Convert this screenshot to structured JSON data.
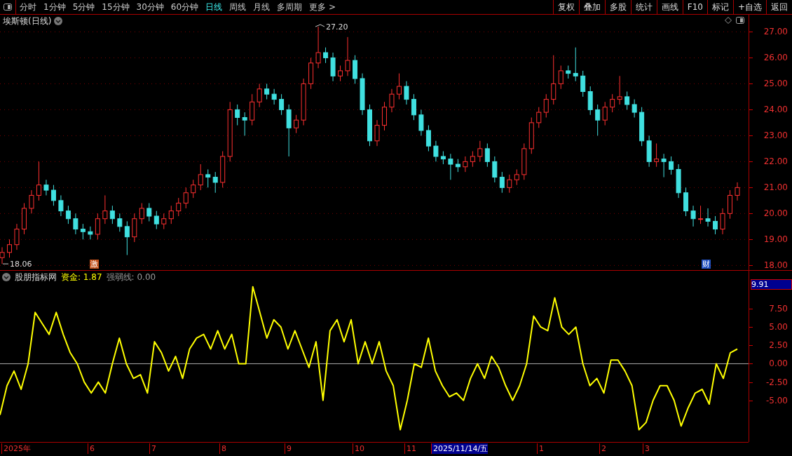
{
  "toolbar": {
    "periods": [
      {
        "label": "分时",
        "selected": false
      },
      {
        "label": "1分钟",
        "selected": false
      },
      {
        "label": "5分钟",
        "selected": false
      },
      {
        "label": "15分钟",
        "selected": false
      },
      {
        "label": "30分钟",
        "selected": false
      },
      {
        "label": "60分钟",
        "selected": false
      },
      {
        "label": "日线",
        "selected": true
      },
      {
        "label": "周线",
        "selected": false
      },
      {
        "label": "月线",
        "selected": false
      },
      {
        "label": "多周期",
        "selected": false
      }
    ],
    "more": "更多 >",
    "buttons": [
      "复权",
      "叠加",
      "多股",
      "统计",
      "画线",
      "F10",
      "标记",
      "+自选",
      "返回"
    ]
  },
  "price_panel": {
    "title": "埃斯顿(日线)",
    "high_label": "27.20",
    "low_label": "18.06",
    "markers": [
      {
        "label": "激",
        "color": "#c0501a"
      },
      {
        "label": "财",
        "color": "#2050c0"
      }
    ],
    "chart_data": {
      "type": "candlestick",
      "ylim": [
        17.82,
        27.66
      ],
      "grid": true,
      "yticks": [
        {
          "value": 27,
          "label": "27.00"
        },
        {
          "value": 26,
          "label": "26.00"
        },
        {
          "value": 25,
          "label": "25.00"
        },
        {
          "value": 24,
          "label": "24.00"
        },
        {
          "value": 23,
          "label": "23.00"
        },
        {
          "value": 22,
          "label": "22.00"
        },
        {
          "value": 21,
          "label": "21.00"
        },
        {
          "value": 20,
          "label": "20.00"
        },
        {
          "value": 19,
          "label": "19.00"
        },
        {
          "value": 18,
          "label": "18.00"
        }
      ],
      "ohlc": [
        [
          18.3,
          18.7,
          18.06,
          18.5
        ],
        [
          18.5,
          19.0,
          18.3,
          18.8
        ],
        [
          18.8,
          19.6,
          18.6,
          19.4
        ],
        [
          19.4,
          20.4,
          19.2,
          20.2
        ],
        [
          20.2,
          20.9,
          20.0,
          20.7
        ],
        [
          20.7,
          22.0,
          20.5,
          21.1
        ],
        [
          21.1,
          21.3,
          20.7,
          20.9
        ],
        [
          20.9,
          21.1,
          20.3,
          20.5
        ],
        [
          20.5,
          20.7,
          19.9,
          20.1
        ],
        [
          20.1,
          20.3,
          19.6,
          19.8
        ],
        [
          19.8,
          20.0,
          19.2,
          19.4
        ],
        [
          19.4,
          19.6,
          19.0,
          19.3
        ],
        [
          19.3,
          19.5,
          19.0,
          19.2
        ],
        [
          19.2,
          20.0,
          19.0,
          19.8
        ],
        [
          19.8,
          20.7,
          19.6,
          20.1
        ],
        [
          20.1,
          20.3,
          19.6,
          19.8
        ],
        [
          19.8,
          20.0,
          19.3,
          19.5
        ],
        [
          19.5,
          19.7,
          18.4,
          19.1
        ],
        [
          19.1,
          20.0,
          18.9,
          19.8
        ],
        [
          19.8,
          20.4,
          19.6,
          20.2
        ],
        [
          20.2,
          20.4,
          19.7,
          19.9
        ],
        [
          19.9,
          20.1,
          19.4,
          19.6
        ],
        [
          19.6,
          20.0,
          19.4,
          19.8
        ],
        [
          19.8,
          20.3,
          19.6,
          20.1
        ],
        [
          20.1,
          20.6,
          19.9,
          20.4
        ],
        [
          20.4,
          21.0,
          20.2,
          20.8
        ],
        [
          20.8,
          21.3,
          20.6,
          21.1
        ],
        [
          21.1,
          21.9,
          20.9,
          21.5
        ],
        [
          21.5,
          21.7,
          21.0,
          21.4
        ],
        [
          21.4,
          21.6,
          20.8,
          21.2
        ],
        [
          21.2,
          22.4,
          21.0,
          22.2
        ],
        [
          22.2,
          24.3,
          22.0,
          24.0
        ],
        [
          24.0,
          24.2,
          23.4,
          23.7
        ],
        [
          23.7,
          23.9,
          23.0,
          23.6
        ],
        [
          23.6,
          24.6,
          23.4,
          24.3
        ],
        [
          24.3,
          25.0,
          24.1,
          24.8
        ],
        [
          24.8,
          25.0,
          24.4,
          24.6
        ],
        [
          24.6,
          24.8,
          24.2,
          24.4
        ],
        [
          24.4,
          24.6,
          23.8,
          24.0
        ],
        [
          24.0,
          24.2,
          22.2,
          23.3
        ],
        [
          23.3,
          23.8,
          23.1,
          23.6
        ],
        [
          23.6,
          25.2,
          23.4,
          25.0
        ],
        [
          25.0,
          26.0,
          24.8,
          25.8
        ],
        [
          25.8,
          27.2,
          25.6,
          26.2
        ],
        [
          26.2,
          26.4,
          25.8,
          26.0
        ],
        [
          26.0,
          26.2,
          25.1,
          25.3
        ],
        [
          25.3,
          25.7,
          25.1,
          25.5
        ],
        [
          25.5,
          26.8,
          25.3,
          25.9
        ],
        [
          25.9,
          26.1,
          25.0,
          25.2
        ],
        [
          25.2,
          25.4,
          23.8,
          24.0
        ],
        [
          24.0,
          24.2,
          22.6,
          22.8
        ],
        [
          22.8,
          23.6,
          22.6,
          23.4
        ],
        [
          23.4,
          24.3,
          23.2,
          24.1
        ],
        [
          24.1,
          24.8,
          23.9,
          24.6
        ],
        [
          24.6,
          25.4,
          24.4,
          24.9
        ],
        [
          24.9,
          25.1,
          24.2,
          24.4
        ],
        [
          24.4,
          24.6,
          23.6,
          23.8
        ],
        [
          23.8,
          24.0,
          23.0,
          23.2
        ],
        [
          23.2,
          23.4,
          22.4,
          22.6
        ],
        [
          22.6,
          22.8,
          22.0,
          22.2
        ],
        [
          22.2,
          22.4,
          21.9,
          22.1
        ],
        [
          22.1,
          22.3,
          21.3,
          21.9
        ],
        [
          21.9,
          22.1,
          21.6,
          21.8
        ],
        [
          21.8,
          22.2,
          21.6,
          22.0
        ],
        [
          22.0,
          22.4,
          21.8,
          22.2
        ],
        [
          22.2,
          22.8,
          22.0,
          22.5
        ],
        [
          22.5,
          22.7,
          21.8,
          22.0
        ],
        [
          22.0,
          22.2,
          21.2,
          21.4
        ],
        [
          21.4,
          21.6,
          20.8,
          21.0
        ],
        [
          21.0,
          21.5,
          20.8,
          21.3
        ],
        [
          21.3,
          21.7,
          21.1,
          21.5
        ],
        [
          21.5,
          22.7,
          21.3,
          22.5
        ],
        [
          22.5,
          23.7,
          22.3,
          23.5
        ],
        [
          23.5,
          24.1,
          23.3,
          23.9
        ],
        [
          23.9,
          24.6,
          23.7,
          24.4
        ],
        [
          24.4,
          26.1,
          24.2,
          25.0
        ],
        [
          25.0,
          25.7,
          24.8,
          25.5
        ],
        [
          25.5,
          25.7,
          25.2,
          25.4
        ],
        [
          25.4,
          26.4,
          25.1,
          25.3
        ],
        [
          25.3,
          25.5,
          24.5,
          24.7
        ],
        [
          24.7,
          24.9,
          23.8,
          24.0
        ],
        [
          24.0,
          24.2,
          23.0,
          23.6
        ],
        [
          23.6,
          24.3,
          23.4,
          24.1
        ],
        [
          24.1,
          24.6,
          23.9,
          24.4
        ],
        [
          24.4,
          25.3,
          24.2,
          24.5
        ],
        [
          24.5,
          24.7,
          24.0,
          24.2
        ],
        [
          24.2,
          24.4,
          23.7,
          23.9
        ],
        [
          23.9,
          24.1,
          22.6,
          22.8
        ],
        [
          22.8,
          23.0,
          21.8,
          22.0
        ],
        [
          22.0,
          22.7,
          21.8,
          22.1
        ],
        [
          22.1,
          22.3,
          21.4,
          22.0
        ],
        [
          22.0,
          22.2,
          21.5,
          21.7
        ],
        [
          21.7,
          21.9,
          20.6,
          20.8
        ],
        [
          20.8,
          21.0,
          19.9,
          20.1
        ],
        [
          20.1,
          20.3,
          19.5,
          19.8
        ],
        [
          19.8,
          20.3,
          19.6,
          19.8
        ],
        [
          19.8,
          20.2,
          19.5,
          19.7
        ],
        [
          19.7,
          19.9,
          19.2,
          19.4
        ],
        [
          19.4,
          20.2,
          19.2,
          20.0
        ],
        [
          20.0,
          20.9,
          19.8,
          20.7
        ],
        [
          20.7,
          21.2,
          20.5,
          21.0
        ]
      ]
    }
  },
  "indicator_panel": {
    "name": "股朋指标网",
    "readings": [
      {
        "text": "资金: 1.87",
        "color": "#ffff00"
      },
      {
        "text": "强弱线: 0.00",
        "color": "#9a9a9a"
      }
    ],
    "current_value": "9.91",
    "chart_data": {
      "type": "line",
      "ylim": [
        -10.67,
        12.67
      ],
      "yticks": [
        {
          "value": 7.5,
          "label": "7.50"
        },
        {
          "value": 5,
          "label": "5.00"
        },
        {
          "value": 2.5,
          "label": "2.50"
        },
        {
          "value": 0,
          "label": "0.00"
        },
        {
          "value": -2.5,
          "label": "-2.50"
        },
        {
          "value": -5,
          "label": "-5.00"
        }
      ],
      "series": [
        {
          "color": "#ffff00",
          "values": [
            -7,
            -3,
            -1,
            -3.5,
            0,
            7,
            5.5,
            4,
            7,
            4,
            1.5,
            0,
            -2.5,
            -4,
            -2.5,
            -4,
            0,
            3.5,
            0,
            -2,
            -1.5,
            -4,
            3,
            1.5,
            -1,
            1,
            -2,
            2,
            3.5,
            4,
            2,
            4.5,
            2,
            4,
            0,
            0,
            10.5,
            7,
            3.5,
            6,
            5,
            2,
            4.5,
            2,
            -0.5,
            3,
            -5,
            4.5,
            6,
            3,
            6,
            0,
            3,
            0,
            3,
            -1,
            -3,
            -9,
            -5,
            0,
            -0.5,
            3.5,
            -1,
            -3,
            -4.5,
            -4,
            -5,
            -2,
            0,
            -2,
            1,
            -0.5,
            -3,
            -5,
            -3,
            0,
            6.5,
            5,
            4.5,
            9,
            5,
            4,
            5,
            0,
            -3,
            -2,
            -4,
            0.5,
            0.5,
            -1,
            -3,
            -9,
            -8,
            -5,
            -3,
            -3,
            -5,
            -8.5,
            -6,
            -4,
            -3.5,
            -5.5,
            0,
            -2,
            1.5,
            2
          ]
        }
      ]
    }
  },
  "time_axis": {
    "labels": [
      {
        "text": "2025年",
        "selected": false
      },
      {
        "text": "6",
        "selected": false
      },
      {
        "text": "7",
        "selected": false
      },
      {
        "text": "8",
        "selected": false
      },
      {
        "text": "9",
        "selected": false
      },
      {
        "text": "10",
        "selected": false
      },
      {
        "text": "11",
        "selected": false
      },
      {
        "text": "2025/11/14/五",
        "selected": true
      },
      {
        "text": "1",
        "selected": false
      },
      {
        "text": "2",
        "selected": false
      },
      {
        "text": "3",
        "selected": false
      }
    ]
  }
}
